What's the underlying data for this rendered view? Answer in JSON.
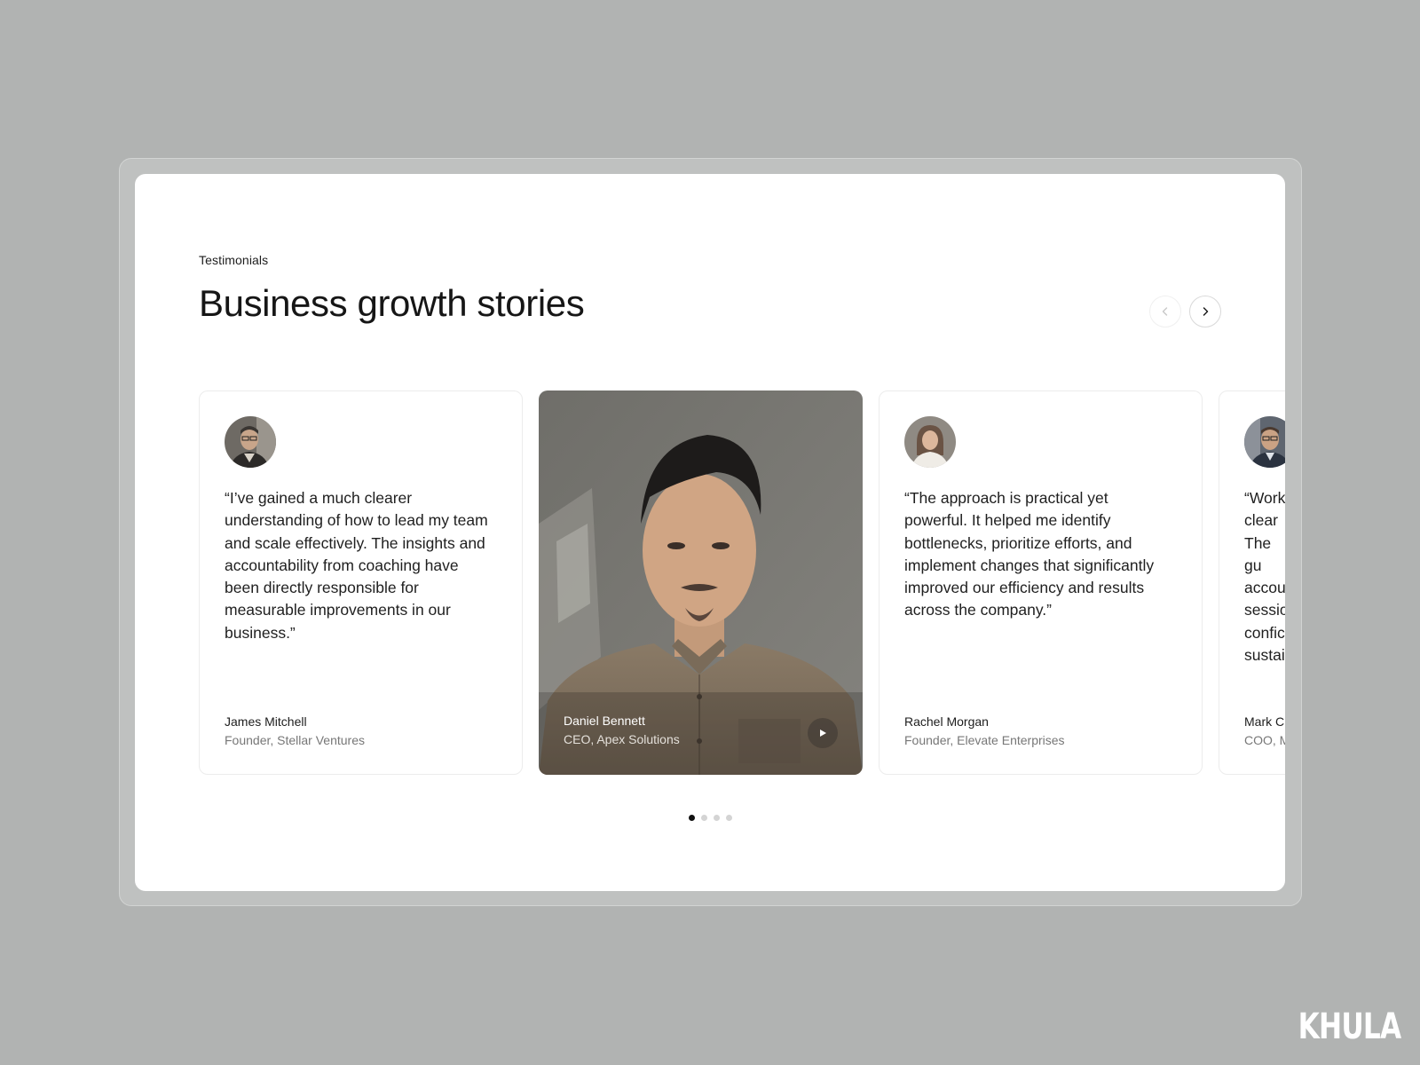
{
  "section": {
    "eyebrow": "Testimonials",
    "title": "Business growth stories"
  },
  "navigation": {
    "prev_icon": "chevron-left-icon",
    "next_icon": "chevron-right-icon"
  },
  "testimonials": [
    {
      "type": "text",
      "quote": "“I’ve gained a much clearer understanding of how to lead my team and scale effectively. The insights and accountability from coaching have been directly responsible for measurable improvements in our business.”",
      "name": "James Mitchell",
      "role": "Founder, Stellar Ventures"
    },
    {
      "type": "video",
      "name": "Daniel Bennett",
      "role": "CEO, Apex Solutions",
      "play_icon": "play-icon"
    },
    {
      "type": "text",
      "quote": "“The approach is practical yet powerful. It helped me identify bottlenecks, prioritize efforts, and implement changes that significantly improved our efficiency and results across the company.”",
      "name": "Rachel Morgan",
      "role": "Founder, Elevate Enterprises"
    },
    {
      "type": "text",
      "quote": "“Working clear The gu accou sessio confic sustai",
      "name": "Mark C",
      "role": "COO, M"
    }
  ],
  "pagination": {
    "count": 4,
    "active_index": 0
  },
  "watermark": "KHULA",
  "colors": {
    "background": "#b1b3b2",
    "card": "#ffffff",
    "active_dot": "#111111",
    "inactive_dot": "#d4d4d4"
  }
}
